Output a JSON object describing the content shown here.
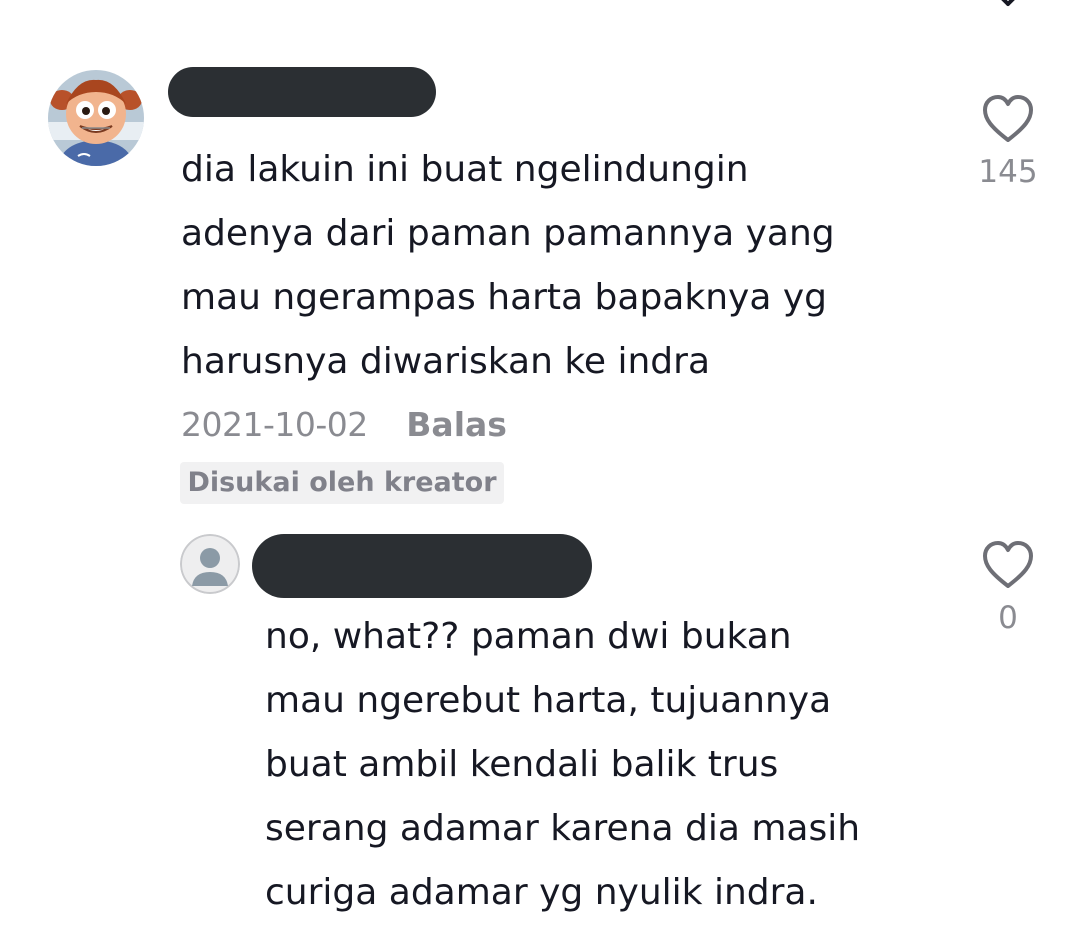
{
  "comment": {
    "lines": [
      "dia lakuin ini buat ngelindungin",
      "adenya dari paman pamannya yang",
      "mau ngerampas harta bapaknya yg",
      "harusnya diwariskan ke indra"
    ],
    "date": "2021-10-02",
    "reply_label": "Balas",
    "creator_badge": "Disukai oleh kreator",
    "like_count": "145"
  },
  "reply": {
    "lines": [
      "no, what?? paman dwi bukan",
      "mau ngerebut harta, tujuannya",
      "buat ambil kendali balik trus",
      "serang adamar karena dia masih",
      "curiga adamar yg nyulik indra."
    ],
    "like_count": "0"
  },
  "icons": {
    "close": "close-icon",
    "like": "heart-outline-icon",
    "default_avatar": "person-placeholder-icon"
  },
  "colors": {
    "text": "#161823",
    "muted": "#8a8b91",
    "redaction": "#2b2f33",
    "badge_bg": "#f1f1f2"
  }
}
